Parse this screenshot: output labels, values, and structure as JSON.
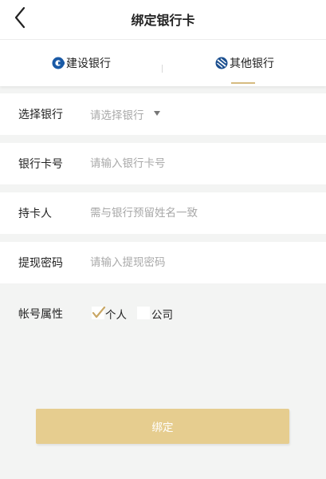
{
  "header": {
    "title": "绑定银行卡"
  },
  "tabs": [
    {
      "label": "建设银行",
      "icon": "ccb-logo-icon",
      "active": false
    },
    {
      "label": "其他银行",
      "icon": "bank-logo-icon",
      "active": true
    }
  ],
  "form": {
    "bank": {
      "label": "选择银行",
      "placeholder": "请选择银行"
    },
    "card_number": {
      "label": "银行卡号",
      "placeholder": "请输入银行卡号"
    },
    "holder": {
      "label": "持卡人",
      "placeholder": "需与银行预留姓名一致"
    },
    "password": {
      "label": "提现密码",
      "placeholder": "请输入提现密码"
    },
    "account_type": {
      "label": "帐号属性",
      "options": [
        {
          "label": "个人",
          "checked": true
        },
        {
          "label": "公司",
          "checked": false
        }
      ]
    }
  },
  "submit": {
    "label": "绑定"
  },
  "colors": {
    "accent": "#d6bb80",
    "button": "#e6cd8f",
    "ccb_blue": "#1a5aa6",
    "other_bank_blue": "#1b4f8f"
  }
}
